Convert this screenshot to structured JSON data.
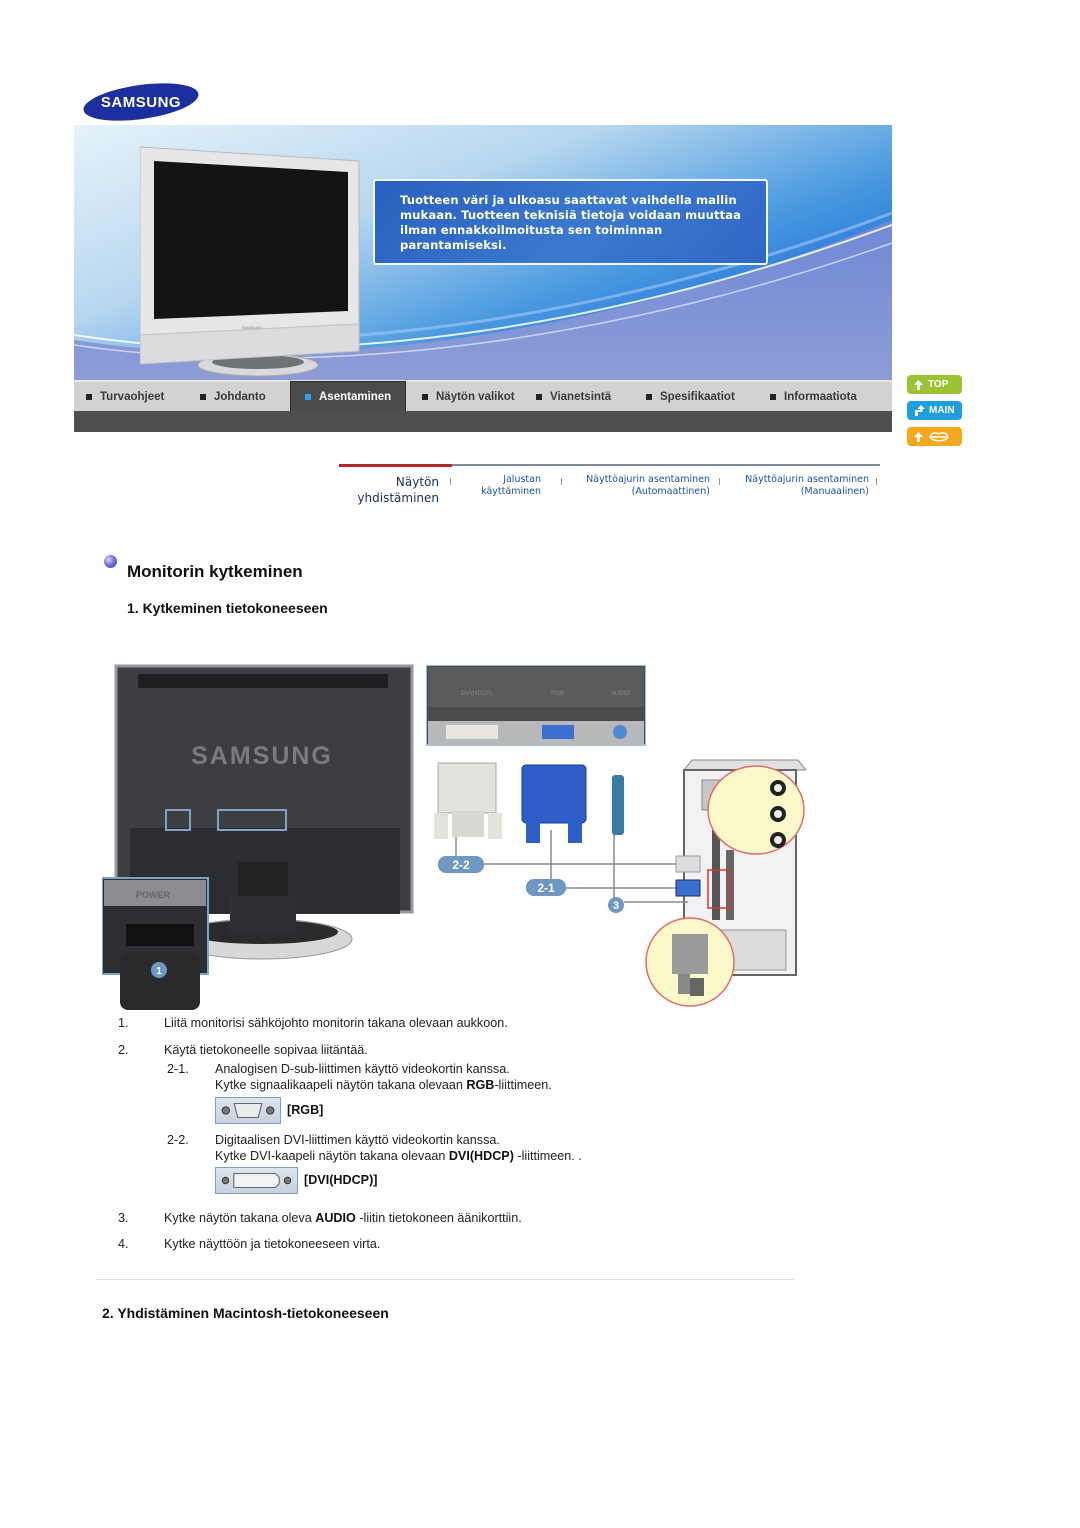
{
  "brand": {
    "logo_text": "SAMSUNG",
    "brand_color": "#1428a0"
  },
  "banner": {
    "notice_lines": [
      "Tuotteen väri ja ulkoasu saattavat vaihdella mallin",
      "mukaan. Tuotteen teknisiä tietoja voidaan muuttaa",
      "ilman ennakkoilmoitusta sen toiminnan",
      "parantamiseksi."
    ]
  },
  "main_nav": {
    "items": [
      {
        "label": "Turvaohjeet",
        "active": false
      },
      {
        "label": "Johdanto",
        "active": false
      },
      {
        "label": "Asentaminen",
        "active": true
      },
      {
        "label": "Näytön valikot",
        "active": false
      },
      {
        "label": "Vianetsintä",
        "active": false
      },
      {
        "label": "Spesifikaatiot",
        "active": false
      },
      {
        "label": "Informaatiota",
        "active": false
      }
    ]
  },
  "side_buttons": {
    "top": {
      "label": "TOP",
      "icon": "arrow-up-icon",
      "color": "#9ac431"
    },
    "main": {
      "label": "MAIN",
      "icon": "arrow-bent-up-icon",
      "color": "#1f9fe0"
    },
    "back": {
      "label": "",
      "icon": "arrow-up-lips-icon",
      "color": "#f6a81c"
    }
  },
  "sub_nav": {
    "tabs": [
      {
        "line1": "Näytön",
        "line2": "yhdistäminen",
        "active": true
      },
      {
        "line1": "Jalustan",
        "line2": "käyttäminen",
        "active": false
      },
      {
        "line1": "Näyttöajurin asentaminen",
        "line2": "(Automaattinen)",
        "active": false
      },
      {
        "line1": "Näyttöajurin asentaminen",
        "line2": "(Manuaalinen)",
        "active": false
      }
    ]
  },
  "content": {
    "title": "Monitorin kytkeminen",
    "section1_title": "1. Kytkeminen tietokoneeseen",
    "illustration": {
      "port_labels": [
        "DVI(HDCP)",
        "RGB",
        "AUDIO"
      ],
      "callouts": [
        "1",
        "2-2",
        "2-1",
        "3"
      ],
      "power_label": "POWER",
      "monitor_brand": "SAMSUNG"
    },
    "steps": [
      {
        "num": "1.",
        "text": "Liitä monitorisi sähköjohto monitorin takana olevaan aukkoon."
      },
      {
        "num": "2.",
        "text": "Käytä tietokoneelle sopivaa liitäntää."
      }
    ],
    "substeps": [
      {
        "num": "2-1.",
        "line1": "Analogisen D-sub-liittimen käyttö videokortin kanssa.",
        "line2_pre": "Kytke signaalikaapeli näytön takana olevaan ",
        "line2_bold": "RGB",
        "line2_post": "-liittimeen.",
        "connector_label": "[RGB]"
      },
      {
        "num": "2-2.",
        "line1": "Digitaalisen DVI-liittimen käyttö videokortin kanssa.",
        "line2_pre": "Kytke DVI-kaapeli näytön takana olevaan ",
        "line2_bold": "DVI(HDCP)",
        "line2_post": " -liittimeen. .",
        "connector_label": "[DVI(HDCP)]"
      }
    ],
    "steps_after": [
      {
        "num": "3.",
        "pre": "Kytke näytön takana oleva ",
        "bold": "AUDIO",
        "post": " -liitin tietokoneen äänikorttiin."
      },
      {
        "num": "4.",
        "pre": "Kytke näyttöön ja tietokoneeseen virta.",
        "bold": "",
        "post": ""
      }
    ],
    "section2_title": "2. Yhdistäminen Macintosh-tietokoneeseen"
  }
}
